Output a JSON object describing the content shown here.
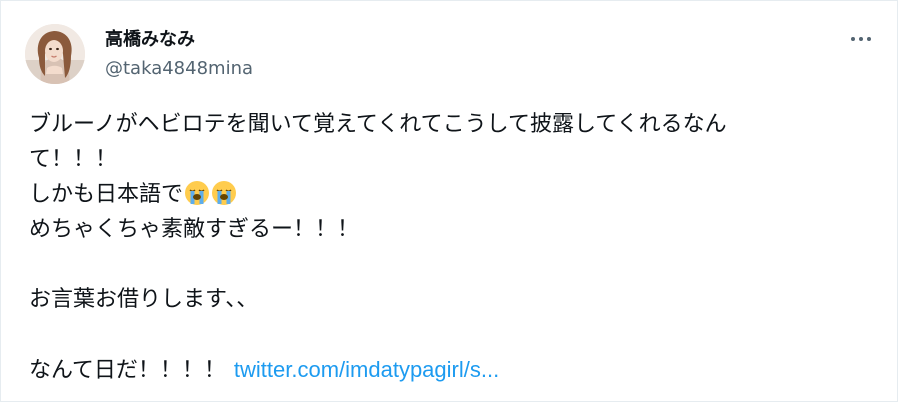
{
  "user": {
    "display_name": "高橋みなみ",
    "handle": "@taka4848mina",
    "avatar_icon": "avatar-photo"
  },
  "more_icon": "more-options-icon",
  "tweet": {
    "line1": "ブルーノがヘビロテを聞いて覚えてくれてこうして披露してくれるなん",
    "line2": "て！！！",
    "line3": "しかも日本語で",
    "line3_emoji": "loudly-crying-face-icon",
    "line4": "めちゃくちゃ素敵すぎるー！！！",
    "line5": "お言葉お借りします、、",
    "line6": "なんて日だ！！！！",
    "link": "twitter.com/imdatypagirl/s...",
    "link_color": "#1d9bf0"
  }
}
